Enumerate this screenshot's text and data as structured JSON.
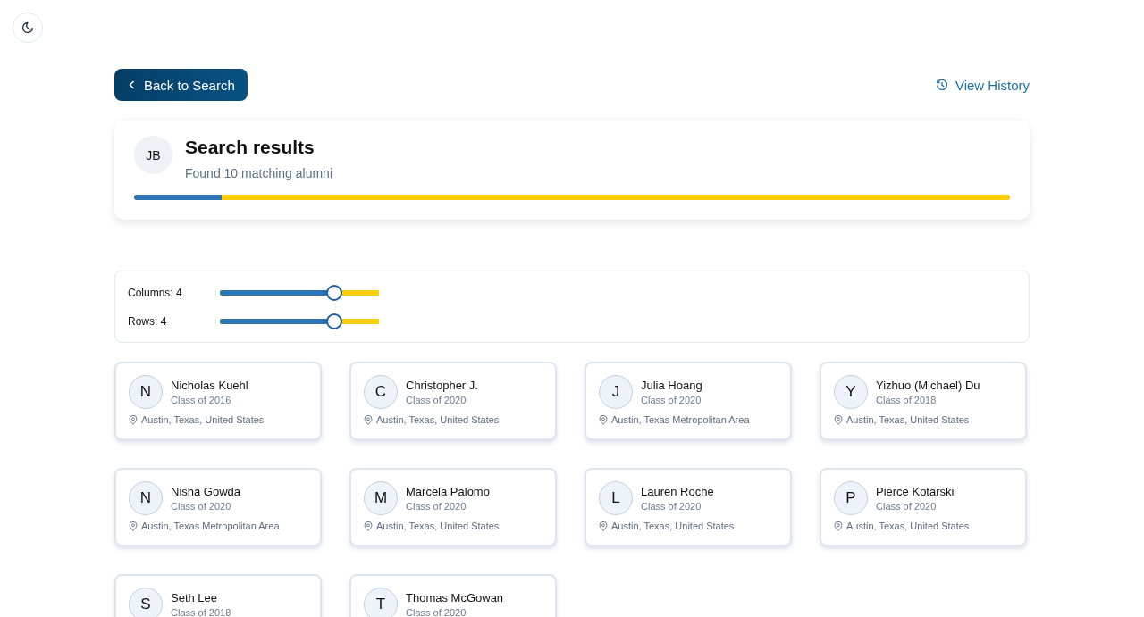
{
  "back_button": {
    "label": "Back to Search"
  },
  "history_link": {
    "label": "View History"
  },
  "header": {
    "initials": "JB",
    "title": "Search results",
    "subtitle": "Found 10 matching alumni",
    "progress": {
      "level": 0.1
    }
  },
  "controls": [
    {
      "label": "Columns: 4",
      "level": 0.72
    },
    {
      "label": "Rows: 4",
      "level": 0.72
    }
  ],
  "alumni": [
    {
      "initial": "N",
      "name": "Nicholas Kuehl",
      "class": "Class of 2016",
      "location": "Austin, Texas, United States"
    },
    {
      "initial": "C",
      "name": "Christopher J.",
      "class": "Class of 2020",
      "location": "Austin, Texas, United States"
    },
    {
      "initial": "J",
      "name": "Julia Hoang",
      "class": "Class of 2020",
      "location": "Austin, Texas Metropolitan Area"
    },
    {
      "initial": "Y",
      "name": "Yizhuo (Michael) Du",
      "class": "Class of 2018",
      "location": "Austin, Texas, United States"
    },
    {
      "initial": "N",
      "name": "Nisha Gowda",
      "class": "Class of 2020",
      "location": "Austin, Texas Metropolitan Area"
    },
    {
      "initial": "M",
      "name": "Marcela Palomo",
      "class": "Class of 2020",
      "location": "Austin, Texas, United States"
    },
    {
      "initial": "L",
      "name": "Lauren Roche",
      "class": "Class of 2020",
      "location": "Austin, Texas, United States"
    },
    {
      "initial": "P",
      "name": "Pierce Kotarski",
      "class": "Class of 2020",
      "location": "Austin, Texas, United States"
    },
    {
      "initial": "S",
      "name": "Seth Lee",
      "class": "Class of 2018"
    },
    {
      "initial": "T",
      "name": "Thomas McGowan",
      "class": "Class of 2020"
    }
  ]
}
